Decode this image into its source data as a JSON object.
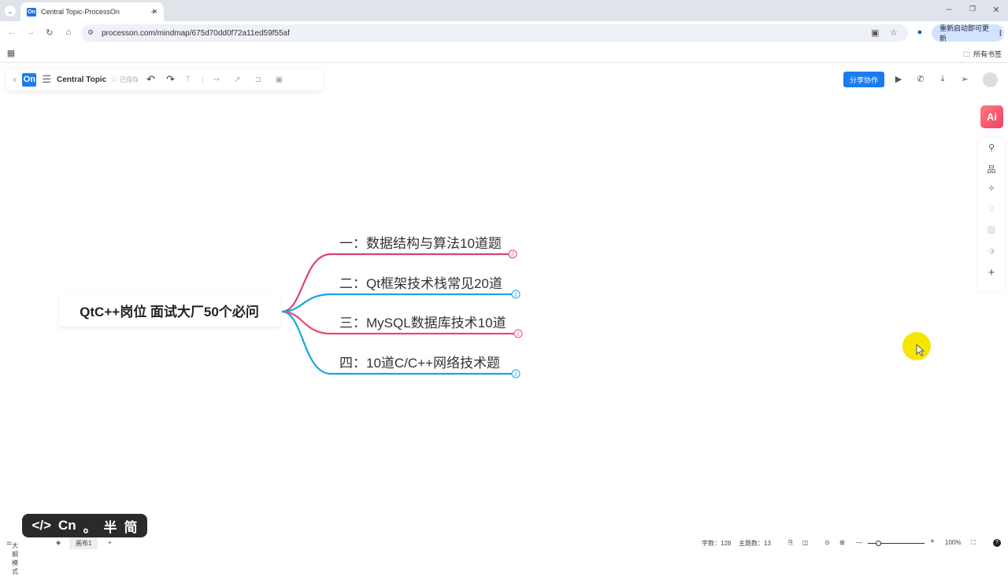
{
  "browser": {
    "tab_title": "Central Topic-ProcessOn",
    "favicon": "On",
    "url": "processon.com/mindmap/675d70dd0f72a11ed59f55af",
    "update_label": "重新启动即可更新",
    "bookmarks_label": "所有书签"
  },
  "toolbar": {
    "logo": "On",
    "doc_title": "Central Topic",
    "save_status": "已保存",
    "share_label": "分享协作"
  },
  "sidebar": {
    "ai_label": "Ai"
  },
  "mindmap": {
    "root": "QtC++岗位 面试大厂50个必问",
    "branches": [
      {
        "label": "一：数据结构与算法10道题",
        "count": "2",
        "color": "#d9407f"
      },
      {
        "label": "二：Qt框架技术栈常见20道",
        "count": "2",
        "color": "#19a6e0"
      },
      {
        "label": "三：MySQL数据库技术10道",
        "count": "2",
        "color": "#ec4a6c"
      },
      {
        "label": "四：10道C/C++网络技术题",
        "count": "2",
        "color": "#19a6e0"
      }
    ]
  },
  "ime": {
    "code": "</>",
    "lang": "Cn",
    "punct": "。",
    "width": "半",
    "script": "简"
  },
  "status": {
    "outline_mode": "大纲模式",
    "canvas_tab": "画布1",
    "word_count": "字数：128",
    "topic_count": "主题数：13",
    "zoom": "100%",
    "zoom_level": 0.2
  }
}
